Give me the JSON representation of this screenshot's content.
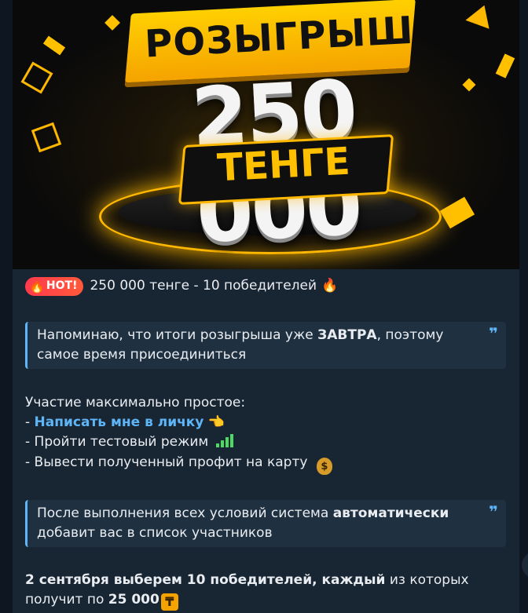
{
  "banner": {
    "line1": "РОЗЫГРЫШ",
    "line2": "250 000",
    "line3": "ТЕНГЕ"
  },
  "hot": {
    "badge": "HOT!",
    "title": "250 000 тенге - 10 победителей",
    "fire_emoji": "🔥"
  },
  "quote1": {
    "text_before": "Напоминаю, что итоги розыгрыша уже ",
    "bold": "ЗАВТРА",
    "text_after": ", поэтому самое время присоединиться"
  },
  "steps": {
    "intro": "Участие максимально простое:",
    "item1_prefix": "- ",
    "item1_link": "Написать мне в личку",
    "item1_emoji": "👈",
    "item2": "- Пройти тестовый режим",
    "item3": "- Вывести полученный профит на карту",
    "item3_emoji": "$"
  },
  "quote2": {
    "text_before": "После выполнения всех условий система ",
    "bold": "автоматически",
    "text_after": " добавит вас в список участников"
  },
  "final": {
    "bold1": "2 сентября выберем 10 победителей, каждый",
    "text1": " из которых получит по ",
    "bold2": "25 000",
    "tenge_symbol": "₸"
  },
  "colors": {
    "bg": "#0e1621",
    "bubble": "#182533",
    "accent": "#5eb5f7",
    "gold": "#ffb800"
  }
}
